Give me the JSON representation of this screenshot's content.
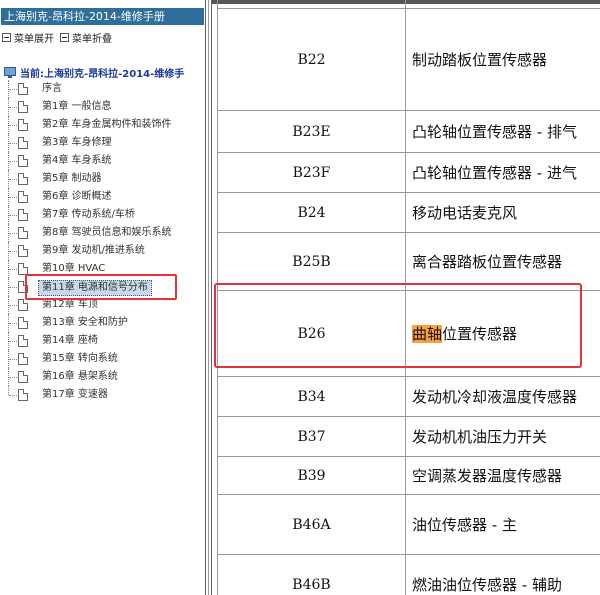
{
  "tree": {
    "title": "上海别克-昂科拉-2014-维修手册",
    "toolbar": {
      "expand_label": "菜单展开",
      "collapse_label": "菜单折叠"
    },
    "root_label": "当前:上海别克-昂科拉-2014-维修手",
    "items": [
      {
        "label": "序言"
      },
      {
        "label": "第1章 一般信息"
      },
      {
        "label": "第2章 车身金属构件和装饰件"
      },
      {
        "label": "第3章 车身修理"
      },
      {
        "label": "第4章 车身系统"
      },
      {
        "label": "第5章 制动器"
      },
      {
        "label": "第6章 诊断概述"
      },
      {
        "label": "第7章 传动系统/车桥"
      },
      {
        "label": "第8章 驾驶员信息和娱乐系统"
      },
      {
        "label": "第9章 发动机/推进系统"
      },
      {
        "label": "第10章 HVAC"
      },
      {
        "label": "第11章 电源和信号分布",
        "selected": true
      },
      {
        "label": "第12章 车顶"
      },
      {
        "label": "第13章 安全和防护"
      },
      {
        "label": "第14章 座椅"
      },
      {
        "label": "第15章 转向系统"
      },
      {
        "label": "第16章 悬架系统"
      },
      {
        "label": "第17章 变速器"
      }
    ]
  },
  "table": {
    "rows": [
      {
        "code": "",
        "desc": ""
      },
      {
        "code": "B22",
        "desc": "制动踏板位置传感器"
      },
      {
        "code": "B23E",
        "desc": "凸轮轴位置传感器 - 排气"
      },
      {
        "code": "B23F",
        "desc": "凸轮轴位置传感器 - 进气"
      },
      {
        "code": "B24",
        "desc": "移动电话麦克风"
      },
      {
        "code": "B25B",
        "desc": "离合器踏板位置传感器"
      },
      {
        "code": "B26",
        "desc_highlight": "曲轴",
        "desc_rest": "位置传感器"
      },
      {
        "code": "B34",
        "desc": "发动机冷却液温度传感器"
      },
      {
        "code": "B37",
        "desc": "发动机机油压力开关"
      },
      {
        "code": "B39",
        "desc": "空调蒸发器温度传感器"
      },
      {
        "code": "B46A",
        "desc": "油位传感器 - 主"
      },
      {
        "code": "B46B",
        "desc": "燃油油位传感器 - 辅助"
      }
    ]
  },
  "colors": {
    "title_bar": "#2f6d9a",
    "highlight": "#ff9e3d",
    "annotation_box": "#e0343a",
    "selection": "#c7d9e8"
  }
}
